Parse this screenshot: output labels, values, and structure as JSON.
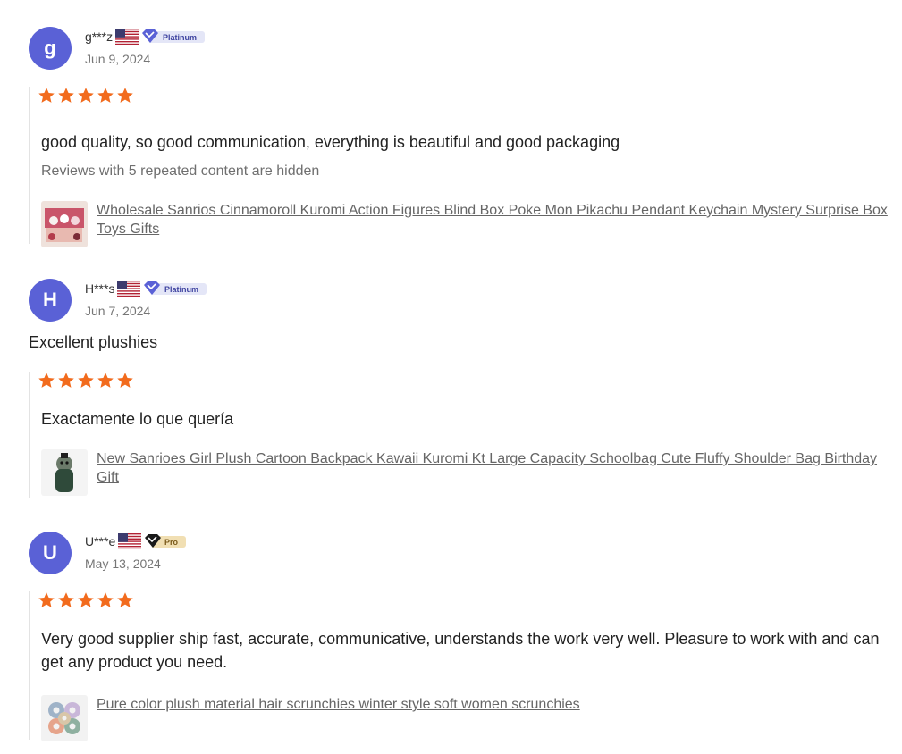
{
  "colors": {
    "avatar": "#5a61d6",
    "star": "#f26b1d",
    "link": "#666666"
  },
  "reviews": [
    {
      "avatar_letter": "g",
      "username": "g***z",
      "flag_icon": "us-flag-icon",
      "badge": "Platinum",
      "date": "Jun 9, 2024",
      "rating": 5,
      "headline": "",
      "text": "good quality, so good communication, everything is beautiful and good packaging",
      "hidden_note": "Reviews with 5 repeated content are hidden",
      "product": "Wholesale Sanrios Cinnamoroll Kuromi Action Figures Blind Box Poke Mon Pikachu Pendant Keychain Mystery Surprise Box Toys Gifts"
    },
    {
      "avatar_letter": "H",
      "username": "H***s",
      "flag_icon": "us-flag-icon",
      "badge": "Platinum",
      "date": "Jun 7, 2024",
      "rating": 5,
      "headline": "Excellent plushies",
      "text": "Exactamente lo que quería",
      "hidden_note": "",
      "product": "New Sanrioes Girl Plush Cartoon Backpack Kawaii Kuromi Kt Large Capacity Schoolbag Cute Fluffy Shoulder Bag Birthday Gift"
    },
    {
      "avatar_letter": "U",
      "username": "U***e",
      "flag_icon": "us-flag-icon",
      "badge": "Pro",
      "date": "May 13, 2024",
      "rating": 5,
      "headline": "",
      "text": "Very good supplier ship fast, accurate, communicative, understands the work very well. Pleasure to work with and can get any product you need.",
      "hidden_note": "",
      "product": "Pure color plush material hair scrunchies winter style soft women scrunchies"
    }
  ]
}
